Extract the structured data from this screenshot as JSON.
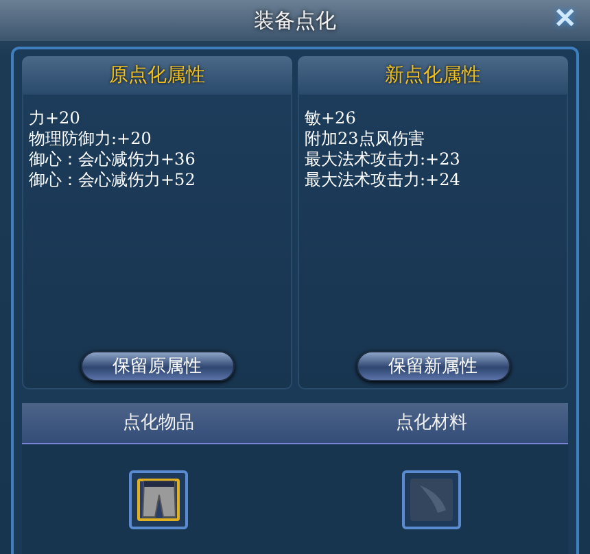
{
  "window": {
    "title": "装备点化",
    "close": "✕"
  },
  "panels": [
    {
      "title": "原点化属性",
      "lines": [
        "力+20",
        "物理防御力:+20",
        "御心：会心减伤力+36",
        "御心：会心减伤力+52"
      ],
      "button": "保留原属性"
    },
    {
      "title": "新点化属性",
      "lines": [
        "敏+26",
        "附加23点风伤害",
        "最大法术攻击力:+23",
        "最大法术攻击力:+24"
      ],
      "button": "保留新属性"
    }
  ],
  "slots": [
    {
      "label": "点化物品",
      "filled": true
    },
    {
      "label": "点化材料",
      "filled": false
    }
  ]
}
